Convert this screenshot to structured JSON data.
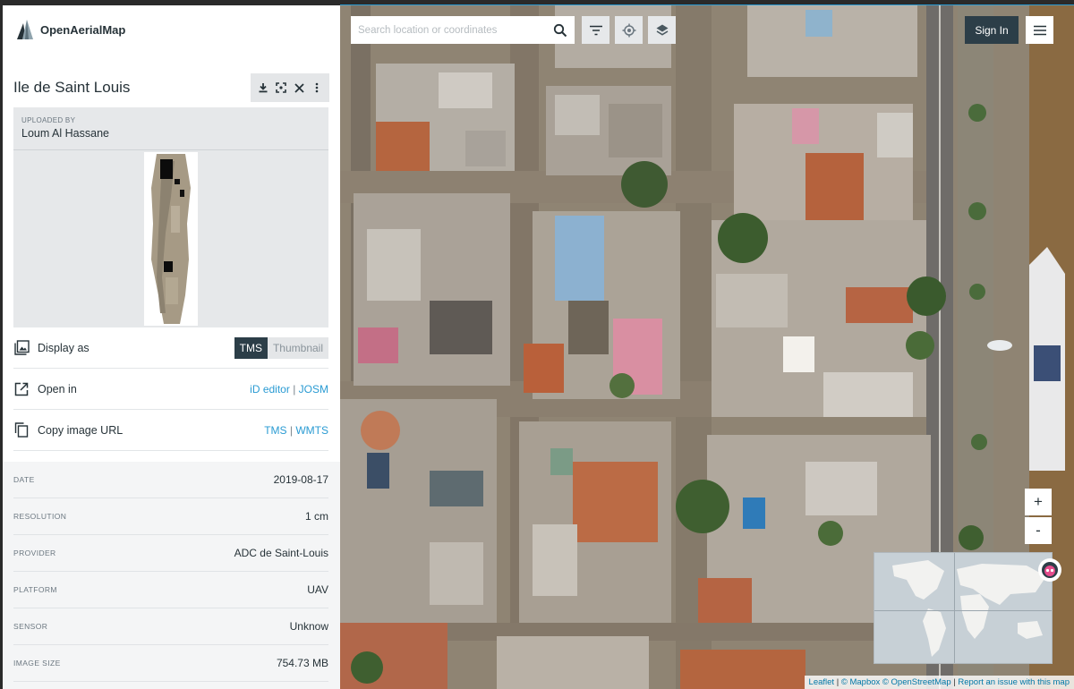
{
  "app": {
    "name": "OpenAerialMap"
  },
  "image": {
    "title": "Ile de Saint Louis"
  },
  "uploader": {
    "caption": "UPLOADED BY",
    "name": "Loum Al Hassane"
  },
  "actions": {
    "display_as": {
      "label": "Display as",
      "options": [
        "TMS",
        "Thumbnail"
      ],
      "selected": "TMS"
    },
    "open_in": {
      "label": "Open in",
      "links": [
        "iD editor",
        "JOSM"
      ],
      "separator": "|"
    },
    "copy_url": {
      "label": "Copy image URL",
      "links": [
        "TMS",
        "WMTS"
      ],
      "separator": "|"
    }
  },
  "metadata": [
    {
      "key": "DATE",
      "value": "2019-08-17"
    },
    {
      "key": "RESOLUTION",
      "value": "1 cm"
    },
    {
      "key": "PROVIDER",
      "value": "ADC de Saint-Louis"
    },
    {
      "key": "PLATFORM",
      "value": "UAV"
    },
    {
      "key": "SENSOR",
      "value": "Unknow"
    },
    {
      "key": "IMAGE SIZE",
      "value": "754.73 MB"
    }
  ],
  "map": {
    "search_placeholder": "Search location or coordinates",
    "sign_in": "Sign In",
    "zoom_in": "+",
    "zoom_out": "-",
    "attribution": {
      "leaflet": "Leaflet",
      "mapbox": "© Mapbox",
      "osm": "© OpenStreetMap",
      "issue": "Report an issue with this map",
      "sep": "|"
    }
  },
  "colors": {
    "accent_dark": "#2c3e48",
    "link": "#2a9bd3"
  }
}
